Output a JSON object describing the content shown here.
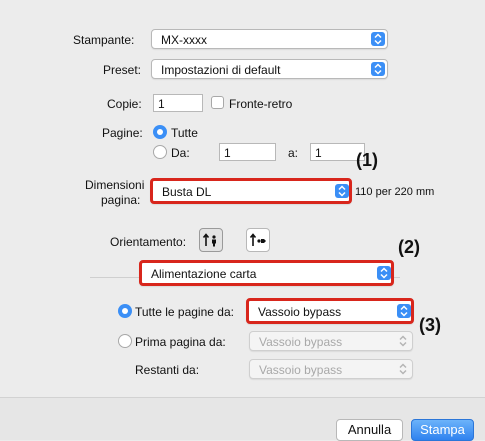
{
  "printer": {
    "label": "Stampante:",
    "value": "MX-xxxx"
  },
  "preset": {
    "label": "Preset:",
    "value": "Impostazioni di default"
  },
  "copies": {
    "label": "Copie:",
    "value": "1",
    "duplex_label": "Fronte-retro"
  },
  "pages": {
    "label": "Pagine:",
    "all_label": "Tutte",
    "range_label": "Da:",
    "from_value": "1",
    "to_label": "a:",
    "to_value": "1"
  },
  "paper_size": {
    "label_line1": "Dimensioni",
    "label_line2": "pagina:",
    "value": "Busta DL",
    "dimensions": "110 per 220 mm"
  },
  "orientation": {
    "label": "Orientamento:"
  },
  "section": {
    "value": "Alimentazione carta"
  },
  "feed": {
    "all_pages_label": "Tutte le pagine da:",
    "all_pages_value": "Vassoio bypass",
    "first_page_label": "Prima pagina da:",
    "first_page_value": "Vassoio bypass",
    "remaining_label": "Restanti da:",
    "remaining_value": "Vassoio bypass"
  },
  "callouts": {
    "c1": "(1)",
    "c2": "(2)",
    "c3": "(3)"
  },
  "buttons": {
    "cancel": "Annulla",
    "print": "Stampa"
  },
  "colors": {
    "accent": "#3b8ff6",
    "highlight": "#d8261c"
  }
}
